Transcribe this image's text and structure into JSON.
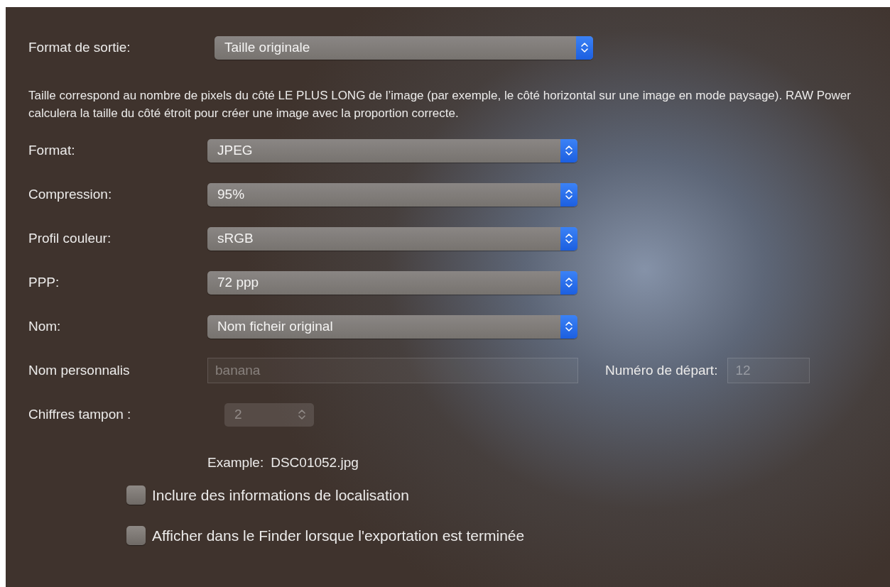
{
  "output_format": {
    "label": "Format de sortie:",
    "value": "Taille originale"
  },
  "description": "Taille correspond au nombre de pixels du côté LE PLUS LONG de l’image (par exemple, le côté horizontal sur une image en mode paysage). RAW Power calculera la taille du côté étroit pour créer une image avec la proportion correcte.",
  "settings": [
    {
      "label": "Format:",
      "value": "JPEG"
    },
    {
      "label": "Compression:",
      "value": "95%"
    },
    {
      "label": "Profil couleur:",
      "value": "sRGB"
    },
    {
      "label": "PPP:",
      "value": "72 ppp"
    },
    {
      "label": "Nom:",
      "value": "Nom ficheir original"
    }
  ],
  "custom_name": {
    "label": "Nom personnalis",
    "value": "banana",
    "disabled": true
  },
  "start_number": {
    "label": "Numéro de départ:",
    "value": "12",
    "disabled": true
  },
  "padding_digits": {
    "label": "Chiffres tampon :",
    "value": "2",
    "disabled": true
  },
  "example": {
    "label": "Example:",
    "value": "DSC01052.jpg"
  },
  "checkboxes": [
    {
      "label": "Inclure des informations de localisation",
      "checked": false
    },
    {
      "label": "Afficher dans le Finder lorsque l'exportation est terminée",
      "checked": false
    }
  ]
}
